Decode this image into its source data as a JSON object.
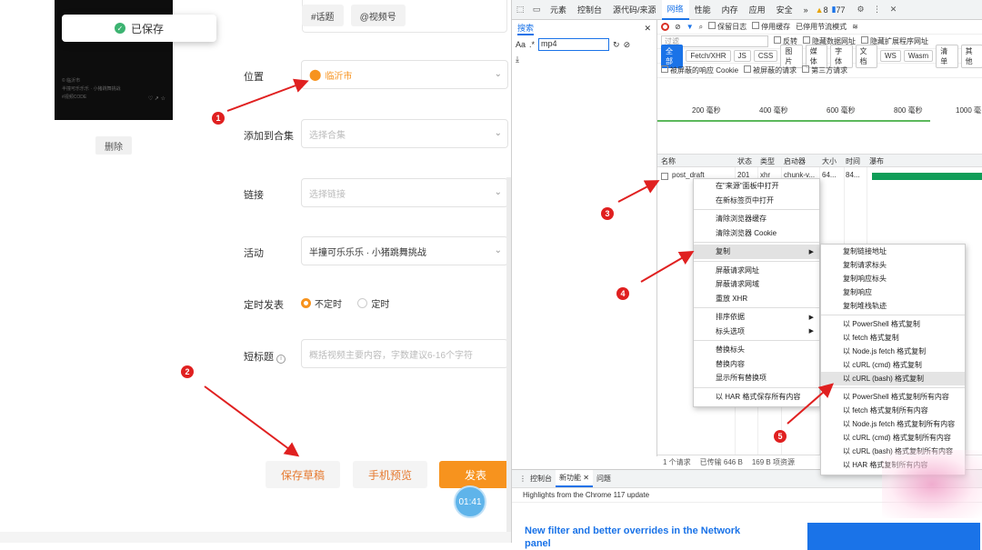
{
  "left": {
    "toast": "已保存",
    "delete_label": "删除",
    "tags": [
      "#话题",
      "@视频号"
    ],
    "location": {
      "label": "位置",
      "value": "临沂市"
    },
    "collection": {
      "label": "添加到合集",
      "placeholder": "选择合集"
    },
    "link": {
      "label": "链接",
      "placeholder": "选择链接"
    },
    "activity": {
      "label": "活动",
      "value": "半撞可乐乐乐 · 小猪跳舞挑战"
    },
    "schedule": {
      "label": "定时发表",
      "options": [
        "不定时",
        "定时"
      ]
    },
    "short_title": {
      "label": "短标题",
      "placeholder": "概括视频主要内容，字数建议6-16个字符"
    },
    "buttons": {
      "draft": "保存草稿",
      "preview": "手机预览",
      "publish": "发表"
    },
    "timer": "01:41",
    "thumb_text": {
      "line1": "© 临沂市",
      "line2": "半撞可乐乐乐 · 小猪跳舞挑战",
      "line3": "#视频CODE"
    }
  },
  "devtools": {
    "tabs": [
      "元素",
      "控制台",
      "源代码/来源",
      "网络",
      "性能",
      "内存",
      "应用",
      "安全",
      "»"
    ],
    "active_tab": "网络",
    "warnings": "8",
    "errors": "77",
    "search": {
      "title": "搜索",
      "aa": "Aa",
      "regex": ".*",
      "query": "mp4"
    },
    "network": {
      "preserve_log": "保留日志",
      "disable_cache": "停用缓存",
      "throttle": "已停用节流模式",
      "filter_placeholder": "过滤",
      "invert": "反转",
      "hide_data_urls": "隐藏数据网址",
      "hide_ext_urls": "隐藏扩展程序网址",
      "types": [
        "全部",
        "Fetch/XHR",
        "JS",
        "CSS",
        "图片",
        "媒体",
        "字体",
        "文档",
        "WS",
        "Wasm",
        "清单",
        "其他"
      ],
      "blocked_cookies": "被屏蔽的响应 Cookie",
      "blocked_requests": "被屏蔽的请求",
      "third_party": "第三方请求",
      "ticks": [
        "200 毫秒",
        "400 毫秒",
        "600 毫秒",
        "800 毫秒",
        "1000 毫"
      ],
      "columns": [
        "名称",
        "状态",
        "类型",
        "启动器",
        "大小",
        "时间",
        "瀑布"
      ],
      "row": {
        "name": "post_draft",
        "status": "201",
        "type": "xhr",
        "initiator": "chunk-v...",
        "size": "64...",
        "time": "84..."
      },
      "status": [
        "1 个请求",
        "已传输 646 B",
        "169 B 项资源"
      ]
    },
    "drawer": {
      "tabs": [
        "控制台",
        "新功能",
        "问题"
      ],
      "active": "新功能",
      "subtitle": "Highlights from the Chrome 117 update",
      "headline": "New filter and better overrides in the Network panel"
    }
  },
  "context_menu": {
    "items": [
      "在\"来源\"面板中打开",
      "在新标签页中打开",
      "清除浏览器缓存",
      "清除浏览器 Cookie",
      "复制",
      "屏蔽请求网址",
      "屏蔽请求网域",
      "重放 XHR",
      "排序依据",
      "标头选项",
      "替换标头",
      "替换内容",
      "显示所有替换项",
      "以 HAR 格式保存所有内容"
    ]
  },
  "copy_submenu": {
    "items": [
      "复制链接地址",
      "复制请求标头",
      "复制响应标头",
      "复制响应",
      "复制堆栈轨迹",
      "以 PowerShell 格式复制",
      "以 fetch 格式复制",
      "以 Node.js fetch 格式复制",
      "以 cURL (cmd) 格式复制",
      "以 cURL (bash) 格式复制",
      "以 PowerShell 格式复制所有内容",
      "以 fetch 格式复制所有内容",
      "以 Node.js fetch 格式复制所有内容",
      "以 cURL (cmd) 格式复制所有内容",
      "以 cURL (bash) 格式复制所有内容",
      "以 HAR 格式复制所有内容"
    ]
  },
  "annotations": [
    "1",
    "2",
    "3",
    "4",
    "5"
  ]
}
